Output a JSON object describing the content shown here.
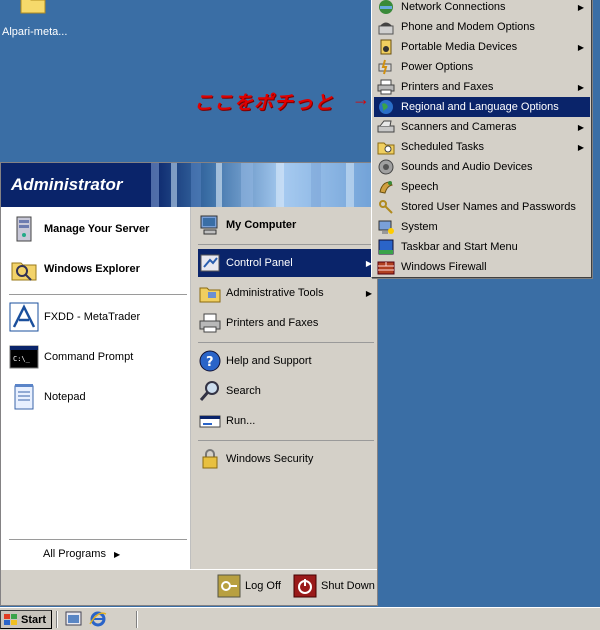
{
  "desktop": {
    "icon_label": "Alpari-meta..."
  },
  "annotation": {
    "text": "ここをポチっと",
    "arrow": "→"
  },
  "start_menu": {
    "user": "Administrator",
    "left_items": [
      {
        "label": "Manage Your Server",
        "bold": true
      },
      {
        "label": "Windows Explorer",
        "bold": true
      },
      {
        "label": "FXDD - MetaTrader",
        "bold": false
      },
      {
        "label": "Command Prompt",
        "bold": false
      },
      {
        "label": "Notepad",
        "bold": false
      }
    ],
    "all_programs": "All Programs",
    "right_items": [
      {
        "label": "My Computer"
      },
      {
        "label": "Control Panel"
      },
      {
        "label": "Administrative Tools"
      },
      {
        "label": "Printers and Faxes"
      },
      {
        "label": "Help and Support"
      },
      {
        "label": "Search"
      },
      {
        "label": "Run..."
      },
      {
        "label": "Windows Security"
      }
    ],
    "log_off": "Log Off",
    "shut_down": "Shut Down"
  },
  "control_panel_submenu": [
    {
      "label": "Network Connections",
      "arrow": true
    },
    {
      "label": "Phone and Modem Options",
      "arrow": false
    },
    {
      "label": "Portable Media Devices",
      "arrow": true
    },
    {
      "label": "Power Options",
      "arrow": false
    },
    {
      "label": "Printers and Faxes",
      "arrow": true
    },
    {
      "label": "Regional and Language Options",
      "arrow": false
    },
    {
      "label": "Scanners and Cameras",
      "arrow": true
    },
    {
      "label": "Scheduled Tasks",
      "arrow": true
    },
    {
      "label": "Sounds and Audio Devices",
      "arrow": false
    },
    {
      "label": "Speech",
      "arrow": false
    },
    {
      "label": "Stored User Names and Passwords",
      "arrow": false
    },
    {
      "label": "System",
      "arrow": false
    },
    {
      "label": "Taskbar and Start Menu",
      "arrow": false
    },
    {
      "label": "Windows Firewall",
      "arrow": false
    }
  ],
  "taskbar": {
    "start_label": "Start"
  },
  "colors": {
    "desktop": "#3a6ea5",
    "selection": "#0a246a",
    "menu_bg": "#d4d0c8",
    "annotation": "#e00000"
  }
}
